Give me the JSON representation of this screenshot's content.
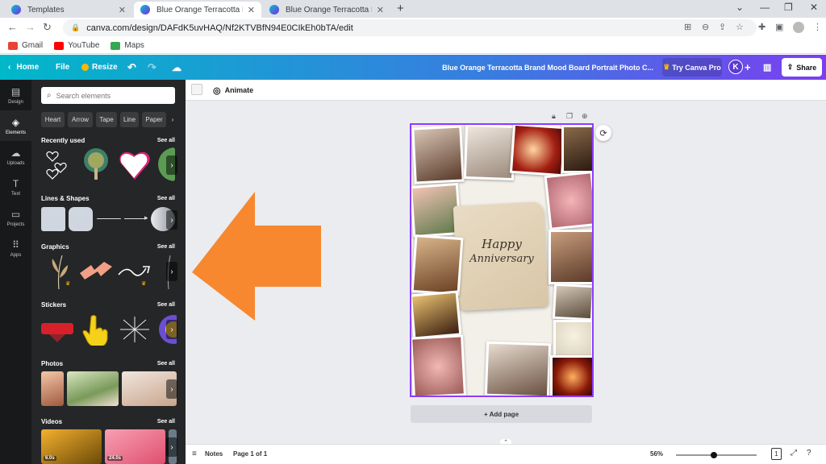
{
  "browser": {
    "tabs": [
      {
        "title": "Templates"
      },
      {
        "title": "Blue Orange Terracotta Brand Mo"
      },
      {
        "title": "Blue Orange Terracotta Brand Mo"
      }
    ],
    "url": "canva.com/design/DAFdK5uvHAQ/Nf2KTVBfN94E0CIkEh0bTA/edit",
    "bookmarks": [
      {
        "label": "Gmail",
        "color": "#ea4335"
      },
      {
        "label": "YouTube",
        "color": "#ff0000"
      },
      {
        "label": "Maps",
        "color": "#34a853"
      }
    ]
  },
  "header": {
    "home": "Home",
    "file": "File",
    "resize": "Resize",
    "design_title": "Blue Orange Terracotta Brand Mood Board Portrait Photo C...",
    "try_pro": "Try Canva Pro",
    "avatar": "K",
    "share": "Share"
  },
  "rail": [
    {
      "label": "Design",
      "icon": "layout-icon"
    },
    {
      "label": "Elements",
      "icon": "shapes-icon"
    },
    {
      "label": "Uploads",
      "icon": "cloud-upload-icon"
    },
    {
      "label": "Text",
      "icon": "text-icon"
    },
    {
      "label": "Projects",
      "icon": "folder-icon"
    },
    {
      "label": "Apps",
      "icon": "grid-icon"
    }
  ],
  "panel": {
    "search_placeholder": "Search elements",
    "chips": [
      "Heart",
      "Arrow",
      "Tape",
      "Line",
      "Paper"
    ],
    "sections": [
      {
        "title": "Recently used",
        "see_all": "See all"
      },
      {
        "title": "Lines & Shapes",
        "see_all": "See all"
      },
      {
        "title": "Graphics",
        "see_all": "See all"
      },
      {
        "title": "Stickers",
        "see_all": "See all"
      },
      {
        "title": "Photos",
        "see_all": "See all"
      },
      {
        "title": "Videos",
        "see_all": "See all"
      }
    ],
    "video_durations": [
      "6.0s",
      "24.0s"
    ]
  },
  "editor": {
    "animate": "Animate",
    "card_line1": "Happy",
    "card_line2": "Anniversary",
    "add_page": "+ Add page",
    "notes": "Notes",
    "page_indicator": "Page 1 of 1",
    "zoom": "56%",
    "page_count": "1"
  },
  "colors": {
    "selection": "#8b3dff",
    "annotation_arrow": "#f7882f"
  }
}
